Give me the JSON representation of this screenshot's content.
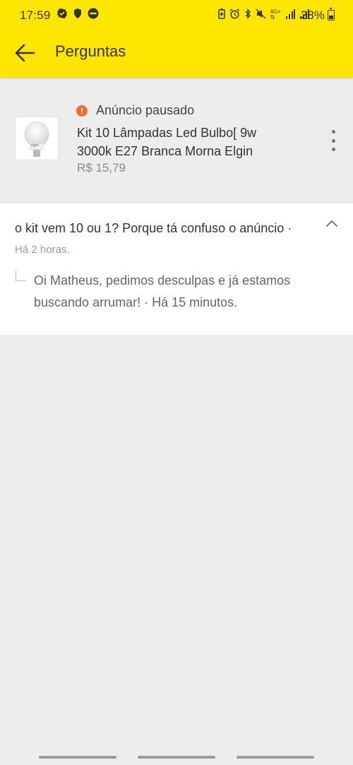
{
  "status_bar": {
    "time": "17:59",
    "battery": "38%",
    "left_icons": [
      "verified-icon",
      "shield-icon",
      "do-not-disturb-icon"
    ],
    "right_icons": [
      "battery-saver-icon",
      "alarm-icon",
      "bluetooth-icon",
      "mute-icon",
      "4g-icon",
      "signal-icon",
      "signal-icon"
    ]
  },
  "header": {
    "title": "Perguntas",
    "back_icon": "arrow-left-icon"
  },
  "product": {
    "status": "Anúncio pausado",
    "name": "Kit 10 Lâmpadas Led Bulbo[ 9w 3000k E27 Branca Morna Elgin",
    "price": "R$ 15,79",
    "thumb_brand": "Elgin",
    "status_color": "#f26c2d"
  },
  "qa": {
    "question": "o kit vem 10 ou 1? Porque tá confuso o anúncio ·",
    "question_time": "Há 2 horas.",
    "answer": "Oi Matheus, pedimos desculpas e já estamos buscando arrumar! ·  Há 15 minutos."
  },
  "colors": {
    "brand_yellow": "#ffe600",
    "background": "#ededed"
  }
}
